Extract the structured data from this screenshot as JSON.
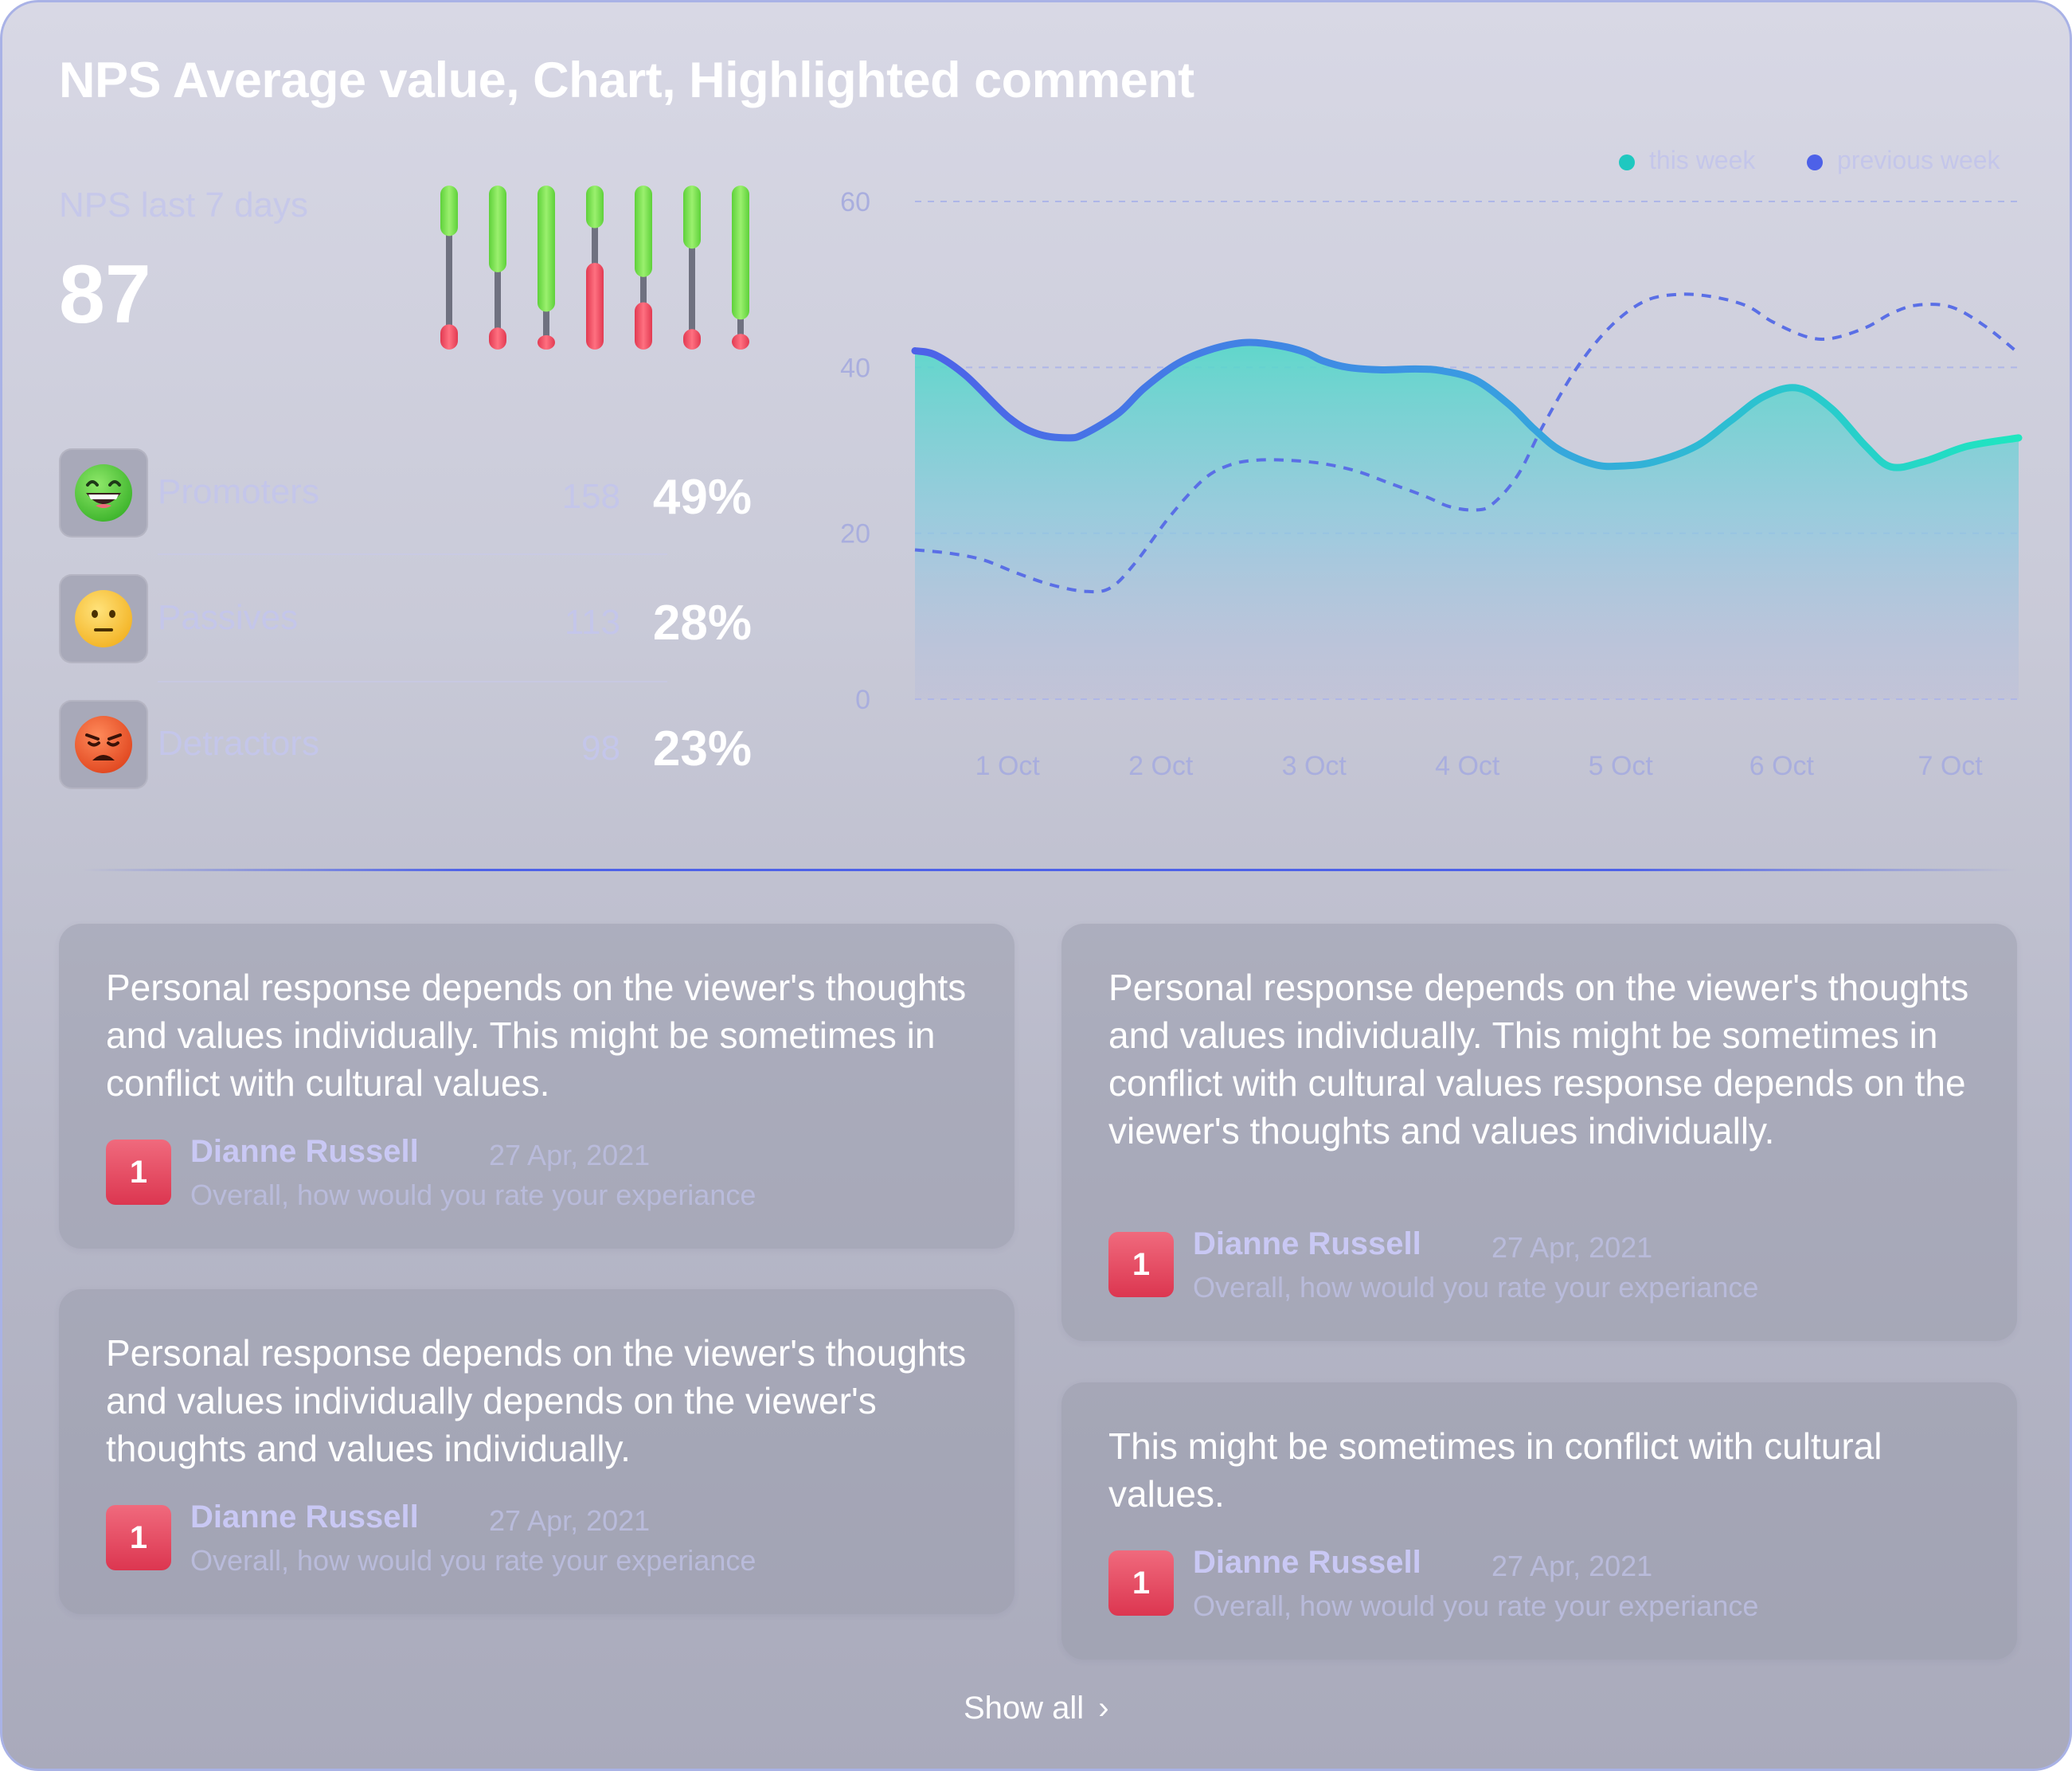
{
  "title": "NPS Average value, Chart, Highlighted comment",
  "nps": {
    "label": "NPS last 7 days",
    "value": "87"
  },
  "mini_bars": [
    {
      "green": 0.32,
      "red": 0.16
    },
    {
      "green": 0.55,
      "red": 0.14
    },
    {
      "green": 0.8,
      "red": 0.0
    },
    {
      "green": 0.27,
      "red": 0.55
    },
    {
      "green": 0.58,
      "red": 0.3
    },
    {
      "green": 0.4,
      "red": 0.13
    },
    {
      "green": 0.85,
      "red": 0.1
    }
  ],
  "categories": [
    {
      "name": "Promoters",
      "count": "158",
      "percent": "49%",
      "icon": "grinning-face-icon"
    },
    {
      "name": "Passives",
      "count": "113",
      "percent": "28%",
      "icon": "neutral-face-icon"
    },
    {
      "name": "Detractors",
      "count": "98",
      "percent": "23%",
      "icon": "angry-face-icon"
    }
  ],
  "chart_data": {
    "type": "area",
    "categories": [
      "1 Oct",
      "2 Oct",
      "3 Oct",
      "4 Oct",
      "5 Oct",
      "6 Oct",
      "7 Oct"
    ],
    "y_ticks": [
      "0",
      "20",
      "40",
      "60"
    ],
    "ylim": [
      0,
      60
    ],
    "grid": true,
    "legend_position": "top-right",
    "series": [
      {
        "name": "this week",
        "x": [
          0,
          0.12,
          0.3,
          0.55,
          0.72,
          0.9,
          1.0,
          1.2,
          1.35,
          1.55,
          1.75,
          1.95,
          2.15,
          2.3,
          2.4,
          2.55,
          2.75,
          2.95,
          3.1,
          3.3,
          3.5,
          3.65,
          3.8,
          4.0,
          4.15,
          4.35,
          4.6,
          4.8,
          5.0,
          5.2,
          5.4,
          5.6,
          5.75,
          5.95,
          6.2,
          6.5
        ],
        "y": [
          42,
          41.5,
          39,
          34,
          32,
          31.5,
          32,
          34.5,
          37.5,
          40.5,
          42.2,
          43,
          42.6,
          41.8,
          40.8,
          40,
          39.7,
          39.8,
          39.6,
          38.5,
          35.5,
          32.5,
          30,
          28.3,
          28.1,
          28.6,
          30.5,
          33.5,
          36.5,
          37.5,
          35,
          30.5,
          28,
          28.7,
          30.5,
          31.5
        ],
        "color": "#1fd6c0"
      },
      {
        "name": "previous week",
        "x": [
          0,
          0.2,
          0.4,
          0.6,
          0.8,
          1.0,
          1.15,
          1.3,
          1.5,
          1.7,
          1.85,
          2.0,
          2.2,
          2.4,
          2.6,
          2.8,
          3.0,
          3.15,
          3.3,
          3.4,
          3.55,
          3.7,
          3.9,
          4.1,
          4.3,
          4.5,
          4.7,
          4.9,
          5.05,
          5.25,
          5.4,
          5.6,
          5.75,
          5.9,
          6.1,
          6.3,
          6.5
        ],
        "y": [
          18,
          17.6,
          16.8,
          15.2,
          13.8,
          13,
          13.4,
          16.5,
          22,
          26.5,
          28.2,
          28.8,
          28.8,
          28.4,
          27.5,
          26,
          24.5,
          23.2,
          22.8,
          23.5,
          27,
          33,
          40,
          45,
          48,
          48.8,
          48.5,
          47.4,
          45.5,
          43.7,
          43.5,
          44.8,
          46.5,
          47.5,
          47.3,
          45,
          41.7
        ],
        "color": "#4d61e8"
      }
    ]
  },
  "comments": [
    {
      "text": "Personal response depends on the viewer's thoughts and values individually. This might be sometimes in conflict with cultural values.",
      "score": "1",
      "author": "Dianne Russell",
      "date": "27 Apr, 2021",
      "question": "Overall, how would you rate your experiance"
    },
    {
      "text": "Personal response depends on the viewer's thoughts and values individually depends on the viewer's thoughts and values individually.",
      "score": "1",
      "author": "Dianne Russell",
      "date": "27 Apr, 2021",
      "question": "Overall, how would you rate your experiance"
    },
    {
      "text": "Personal response depends on the viewer's thoughts and values individually. This might be sometimes in conflict with cultural values response depends on the viewer's thoughts and values individually.",
      "score": "1",
      "author": "Dianne Russell",
      "date": "27 Apr, 2021",
      "question": "Overall, how would you rate your experiance"
    },
    {
      "text": "This might be sometimes in conflict with cultural values.",
      "score": "1",
      "author": "Dianne Russell",
      "date": "27 Apr, 2021",
      "question": "Overall, how would you rate your experiance"
    }
  ],
  "show_all_label": "Show all",
  "colors": {
    "accent": "#4d61e8",
    "this_week": "#1fd6c0",
    "promoter_green": "#7ddf52",
    "detractor_red": "#ea4a60"
  }
}
